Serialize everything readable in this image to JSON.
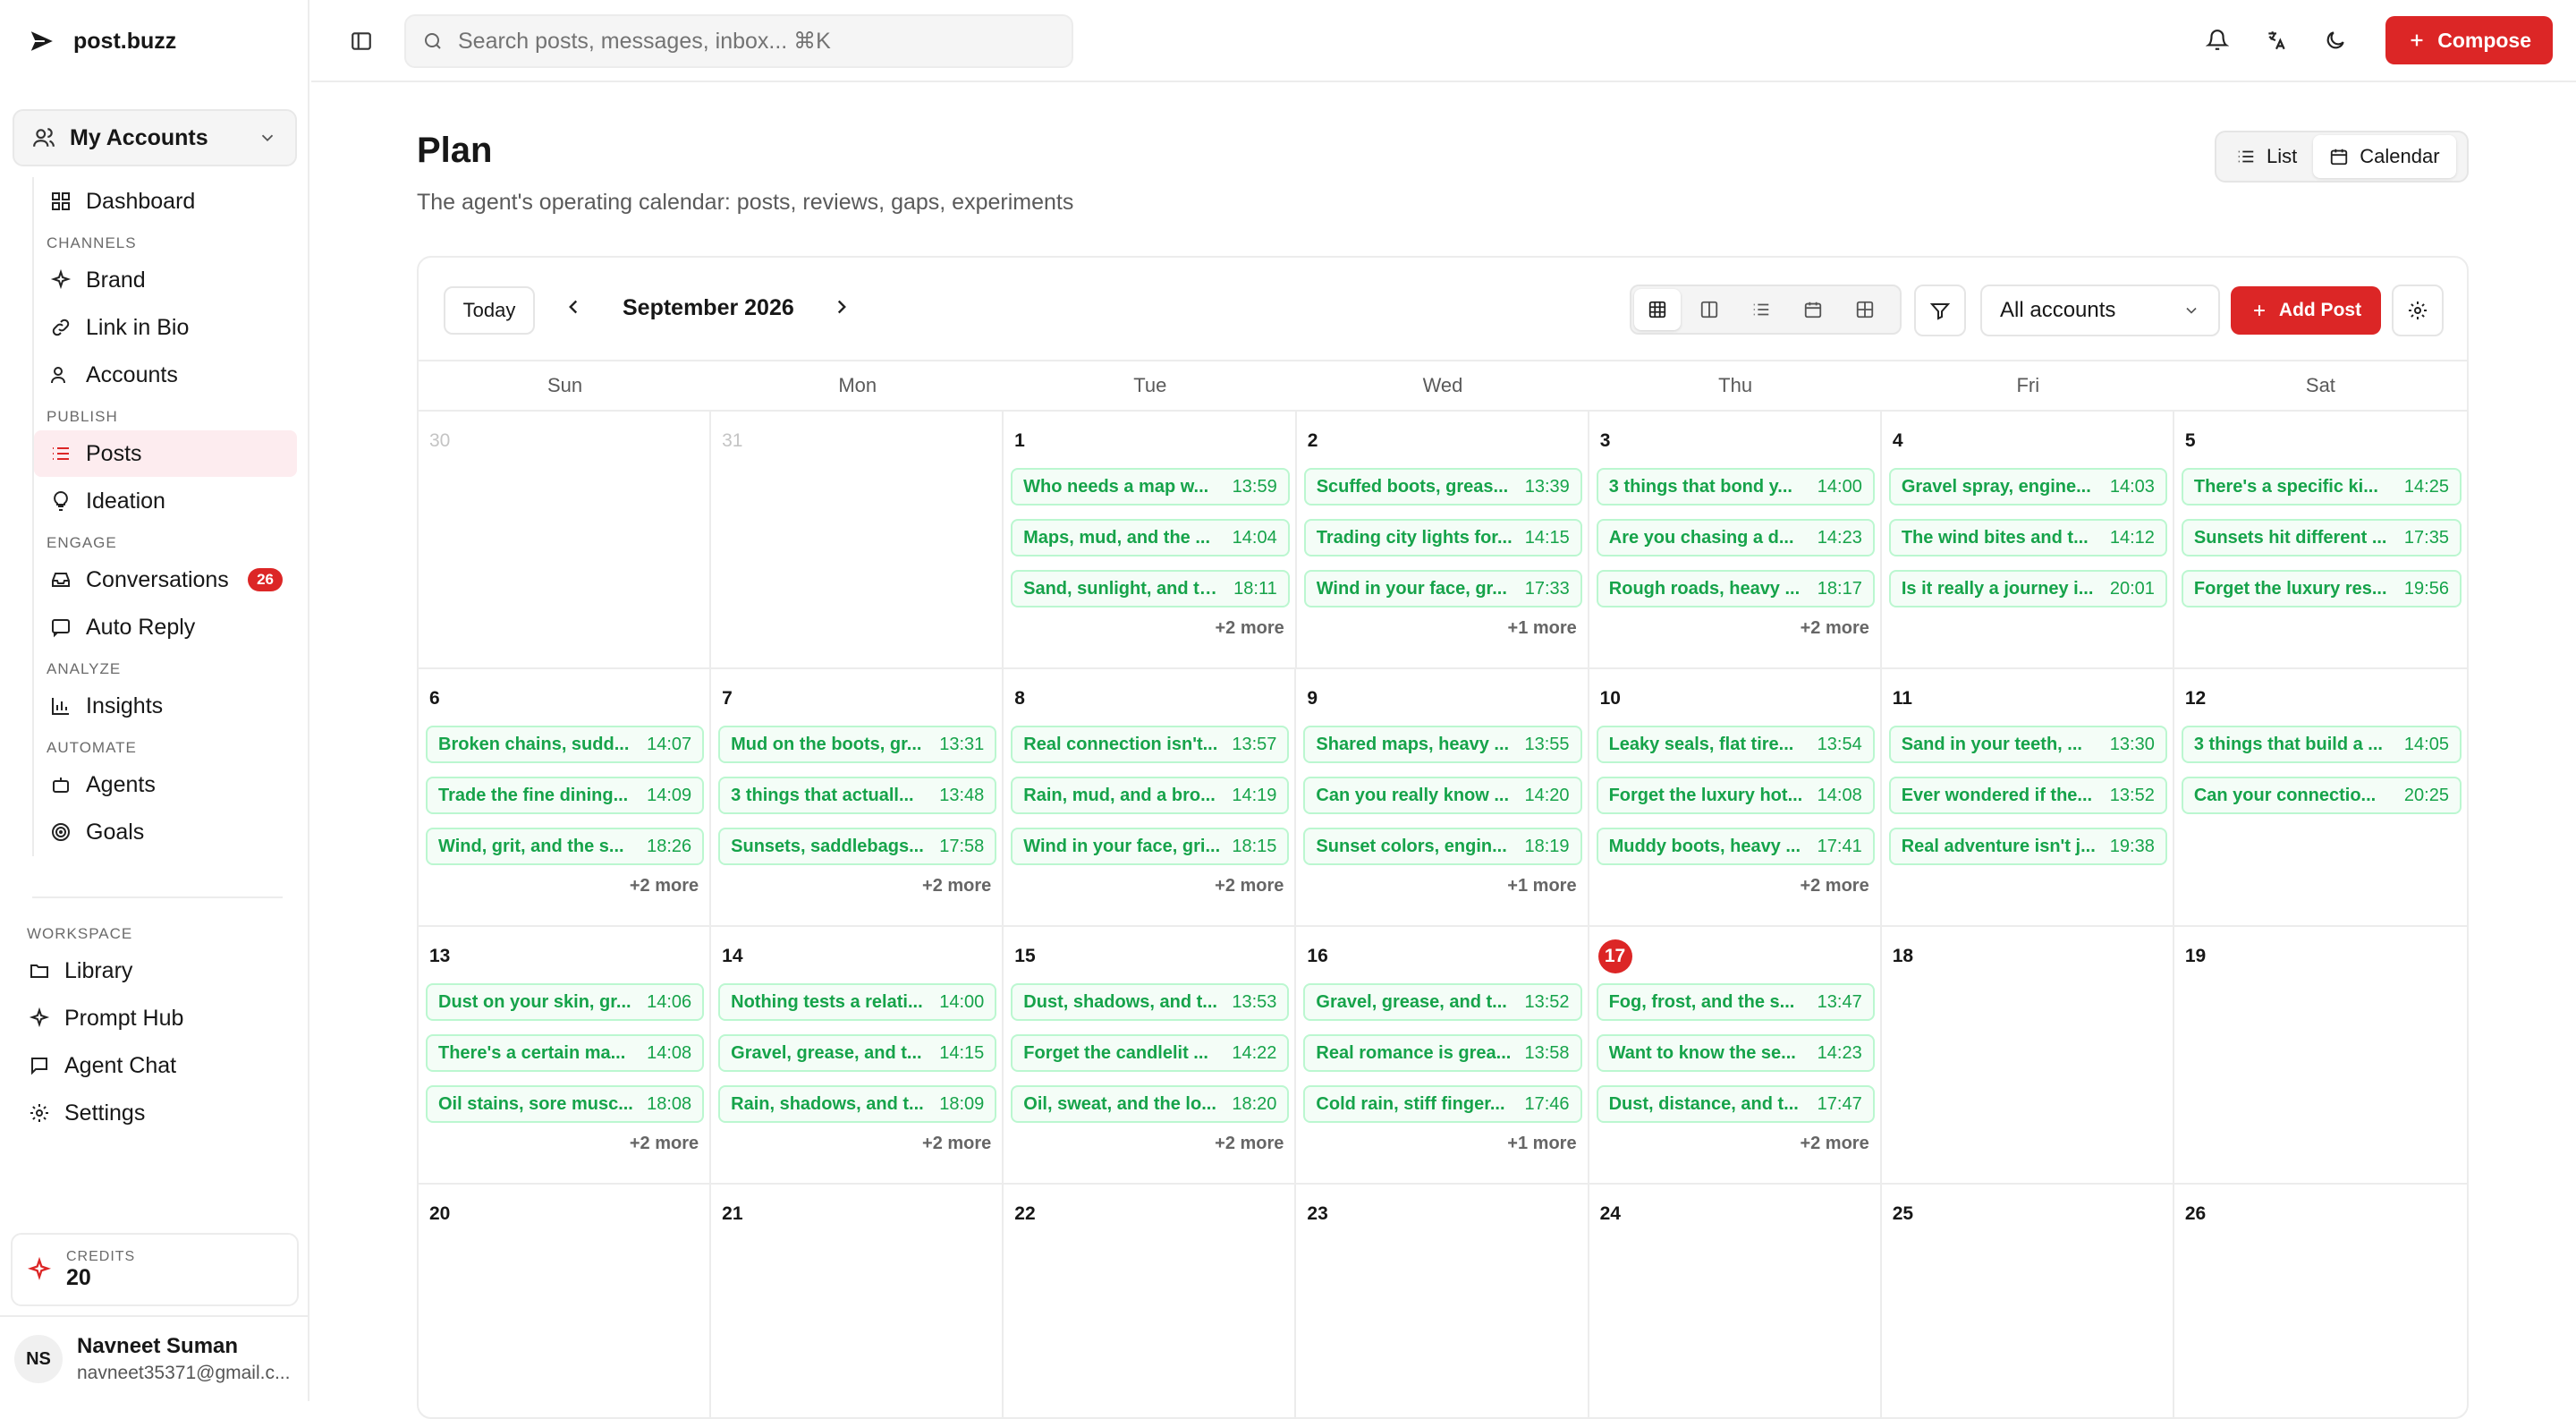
{
  "app": {
    "name": "post.buzz"
  },
  "sidebar": {
    "account_selector": "My Accounts",
    "dashboard": "Dashboard",
    "sections": [
      {
        "title": "CHANNELS",
        "items": [
          {
            "label": "Brand",
            "icon": "sparkles-icon"
          },
          {
            "label": "Link in Bio",
            "icon": "link-icon"
          },
          {
            "label": "Accounts",
            "icon": "users-icon"
          }
        ]
      },
      {
        "title": "PUBLISH",
        "items": [
          {
            "label": "Posts",
            "icon": "list-icon",
            "active": true
          },
          {
            "label": "Ideation",
            "icon": "lightbulb-icon"
          }
        ]
      },
      {
        "title": "ENGAGE",
        "items": [
          {
            "label": "Conversations",
            "icon": "inbox-icon",
            "badge": "26"
          },
          {
            "label": "Auto Reply",
            "icon": "message-bot-icon"
          }
        ]
      },
      {
        "title": "ANALYZE",
        "items": [
          {
            "label": "Insights",
            "icon": "bar-chart-icon"
          }
        ]
      },
      {
        "title": "AUTOMATE",
        "items": [
          {
            "label": "Agents",
            "icon": "bot-icon"
          },
          {
            "label": "Goals",
            "icon": "target-icon"
          }
        ]
      }
    ],
    "workspace": {
      "title": "WORKSPACE",
      "items": [
        {
          "label": "Library",
          "icon": "folder-icon"
        },
        {
          "label": "Prompt Hub",
          "icon": "sparkles-icon"
        },
        {
          "label": "Agent Chat",
          "icon": "chat-icon"
        },
        {
          "label": "Settings",
          "icon": "gear-icon"
        }
      ]
    },
    "credits": {
      "label": "CREDITS",
      "value": "20"
    },
    "user": {
      "initials": "NS",
      "name": "Navneet Suman",
      "email": "navneet35371@gmail.c..."
    }
  },
  "topbar": {
    "search_placeholder": "Search posts, messages, inbox... ⌘K",
    "compose": "Compose"
  },
  "page": {
    "title": "Plan",
    "subtitle": "The agent's operating calendar: posts, reviews, gaps, experiments",
    "view_list": "List",
    "view_calendar": "Calendar"
  },
  "calendar": {
    "today": "Today",
    "month": "September 2026",
    "account_filter": "All accounts",
    "add_post": "Add Post",
    "weekdays": [
      "Sun",
      "Mon",
      "Tue",
      "Wed",
      "Thu",
      "Fri",
      "Sat"
    ],
    "weeks": [
      [
        {
          "day": "30",
          "muted": true,
          "posts": []
        },
        {
          "day": "31",
          "muted": true,
          "posts": []
        },
        {
          "day": "1",
          "posts": [
            {
              "t": "Who needs a map w...",
              "time": "13:59"
            },
            {
              "t": "Maps, mud, and the ...",
              "time": "14:04"
            },
            {
              "t": "Sand, sunlight, and th...",
              "time": "18:11"
            }
          ],
          "more": "+2 more"
        },
        {
          "day": "2",
          "posts": [
            {
              "t": "Scuffed boots, greas...",
              "time": "13:39"
            },
            {
              "t": "Trading city lights for...",
              "time": "14:15"
            },
            {
              "t": "Wind in your face, gr...",
              "time": "17:33"
            }
          ],
          "more": "+1 more"
        },
        {
          "day": "3",
          "posts": [
            {
              "t": "3 things that bond y...",
              "time": "14:00"
            },
            {
              "t": "Are you chasing a d...",
              "time": "14:23"
            },
            {
              "t": "Rough roads, heavy ...",
              "time": "18:17"
            }
          ],
          "more": "+2 more"
        },
        {
          "day": "4",
          "posts": [
            {
              "t": "Gravel spray, engine...",
              "time": "14:03"
            },
            {
              "t": "The wind bites and t...",
              "time": "14:12"
            },
            {
              "t": "Is it really a journey i...",
              "time": "20:01"
            }
          ]
        },
        {
          "day": "5",
          "posts": [
            {
              "t": "There's a specific ki...",
              "time": "14:25"
            },
            {
              "t": "Sunsets hit different ...",
              "time": "17:35"
            },
            {
              "t": "Forget the luxury res...",
              "time": "19:56"
            }
          ]
        }
      ],
      [
        {
          "day": "6",
          "posts": [
            {
              "t": "Broken chains, sudd...",
              "time": "14:07"
            },
            {
              "t": "Trade the fine dining...",
              "time": "14:09"
            },
            {
              "t": "Wind, grit, and the s...",
              "time": "18:26"
            }
          ],
          "more": "+2 more"
        },
        {
          "day": "7",
          "posts": [
            {
              "t": "Mud on the boots, gr...",
              "time": "13:31"
            },
            {
              "t": "3 things that actuall...",
              "time": "13:48"
            },
            {
              "t": "Sunsets, saddlebags...",
              "time": "17:58"
            }
          ],
          "more": "+2 more"
        },
        {
          "day": "8",
          "posts": [
            {
              "t": "Real connection isn't...",
              "time": "13:57"
            },
            {
              "t": "Rain, mud, and a bro...",
              "time": "14:19"
            },
            {
              "t": "Wind in your face, gri...",
              "time": "18:15"
            }
          ],
          "more": "+2 more"
        },
        {
          "day": "9",
          "posts": [
            {
              "t": "Shared maps, heavy ...",
              "time": "13:55"
            },
            {
              "t": "Can you really know ...",
              "time": "14:20"
            },
            {
              "t": "Sunset colors, engin...",
              "time": "18:19"
            }
          ],
          "more": "+1 more"
        },
        {
          "day": "10",
          "posts": [
            {
              "t": "Leaky seals, flat tire...",
              "time": "13:54"
            },
            {
              "t": "Forget the luxury hot...",
              "time": "14:08"
            },
            {
              "t": "Muddy boots, heavy ...",
              "time": "17:41"
            }
          ],
          "more": "+2 more"
        },
        {
          "day": "11",
          "posts": [
            {
              "t": "Sand in your teeth, ...",
              "time": "13:30"
            },
            {
              "t": "Ever wondered if the...",
              "time": "13:52"
            },
            {
              "t": "Real adventure isn't j...",
              "time": "19:38"
            }
          ]
        },
        {
          "day": "12",
          "posts": [
            {
              "t": "3 things that build a ...",
              "time": "14:05"
            },
            {
              "t": "Can your connectio...",
              "time": "20:25"
            }
          ]
        }
      ],
      [
        {
          "day": "13",
          "posts": [
            {
              "t": "Dust on your skin, gr...",
              "time": "14:06"
            },
            {
              "t": "There's a certain ma...",
              "time": "14:08"
            },
            {
              "t": "Oil stains, sore musc...",
              "time": "18:08"
            }
          ],
          "more": "+2 more"
        },
        {
          "day": "14",
          "posts": [
            {
              "t": "Nothing tests a relati...",
              "time": "14:00"
            },
            {
              "t": "Gravel, grease, and t...",
              "time": "14:15"
            },
            {
              "t": "Rain, shadows, and t...",
              "time": "18:09"
            }
          ],
          "more": "+2 more"
        },
        {
          "day": "15",
          "posts": [
            {
              "t": "Dust, shadows, and t...",
              "time": "13:53"
            },
            {
              "t": "Forget the candlelit ...",
              "time": "14:22"
            },
            {
              "t": "Oil, sweat, and the lo...",
              "time": "18:20"
            }
          ],
          "more": "+2 more"
        },
        {
          "day": "16",
          "posts": [
            {
              "t": "Gravel, grease, and t...",
              "time": "13:52"
            },
            {
              "t": "Real romance is grea...",
              "time": "13:58"
            },
            {
              "t": "Cold rain, stiff finger...",
              "time": "17:46"
            }
          ],
          "more": "+1 more"
        },
        {
          "day": "17",
          "today": true,
          "posts": [
            {
              "t": "Fog, frost, and the s...",
              "time": "13:47"
            },
            {
              "t": "Want to know the se...",
              "time": "14:23"
            },
            {
              "t": "Dust, distance, and t...",
              "time": "17:47"
            }
          ],
          "more": "+2 more"
        },
        {
          "day": "18",
          "posts": []
        },
        {
          "day": "19",
          "posts": []
        }
      ],
      [
        {
          "day": "20",
          "posts": []
        },
        {
          "day": "21",
          "posts": []
        },
        {
          "day": "22",
          "posts": []
        },
        {
          "day": "23",
          "posts": []
        },
        {
          "day": "24",
          "posts": []
        },
        {
          "day": "25",
          "posts": []
        },
        {
          "day": "26",
          "posts": []
        }
      ]
    ]
  },
  "colors": {
    "accent": "#dc2626",
    "post_text": "#16a34a",
    "post_border": "#bbf7d0",
    "active_nav": "#fdecef"
  }
}
